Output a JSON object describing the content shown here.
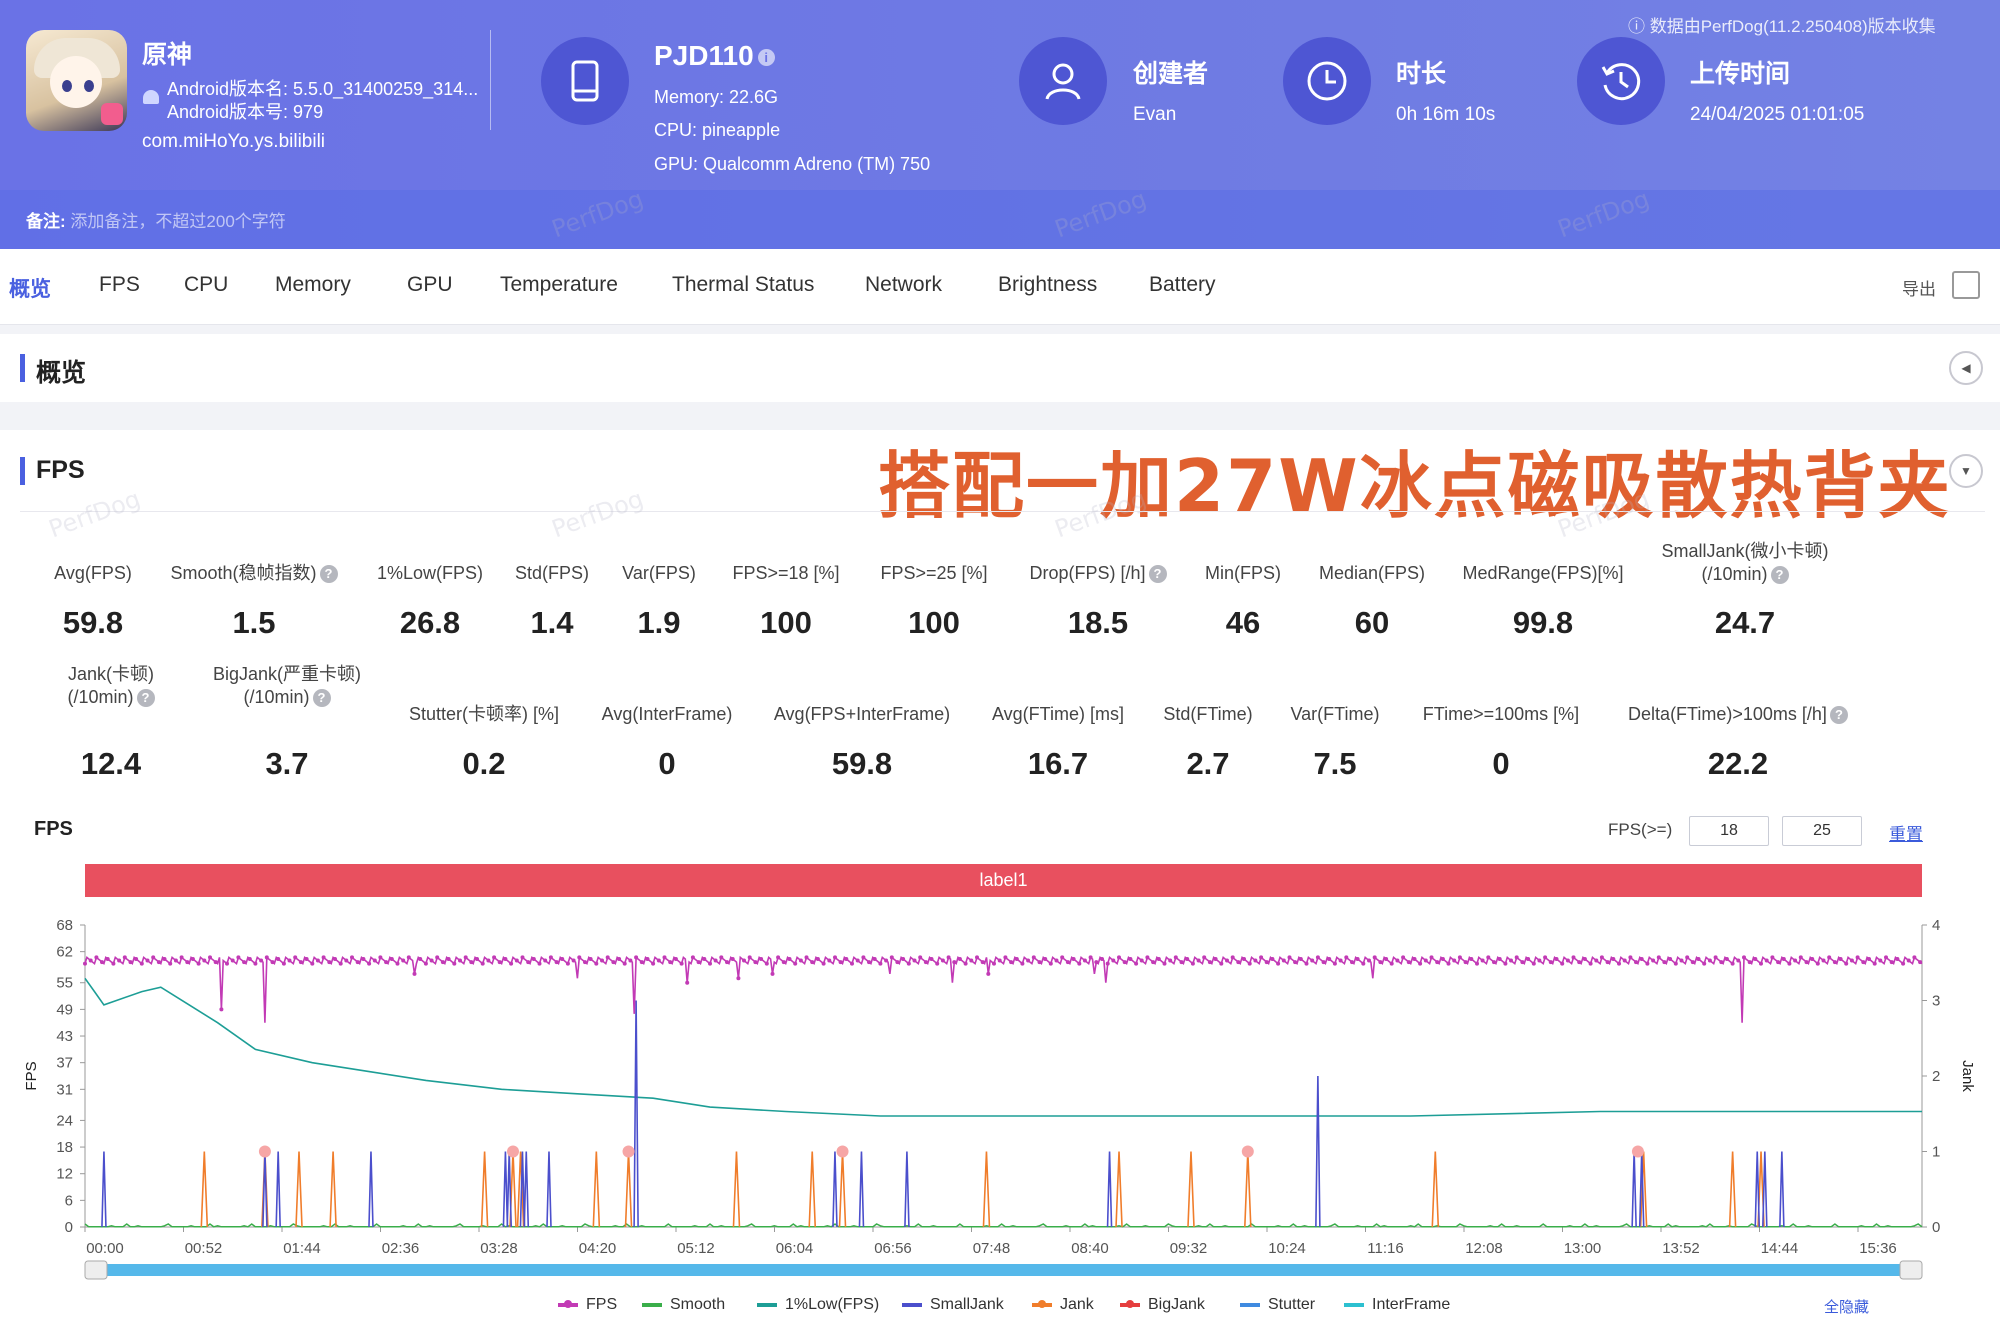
{
  "header": {
    "app_name": "原神",
    "app_version_name": "Android版本名: 5.5.0_31400259_314...",
    "app_version_code": "Android版本号: 979",
    "package": "com.miHoYo.ys.bilibili",
    "device": {
      "name": "PJD110",
      "info_icon": "i",
      "memory": "Memory: 22.6G",
      "cpu": "CPU: pineapple",
      "gpu": "GPU: Qualcomm Adreno (TM) 750"
    },
    "creator": {
      "label": "创建者",
      "value": "Evan"
    },
    "duration": {
      "label": "时长",
      "value": "0h 16m 10s"
    },
    "upload": {
      "label": "上传时间",
      "value": "24/04/2025 01:01:05"
    },
    "source_note": "ⓘ 数据由PerfDog(11.2.250408)版本收集",
    "remark_label": "备注:",
    "remark_placeholder": "添加备注，不超过200个字符",
    "watermark": "PerfDog"
  },
  "tabs": [
    "概览",
    "FPS",
    "CPU",
    "Memory",
    "GPU",
    "Temperature",
    "Thermal Status",
    "Network",
    "Brightness",
    "Battery"
  ],
  "active_tab": "概览",
  "export_label": "导出",
  "overview_title": "概览",
  "fps_section": {
    "title": "FPS",
    "promo_text": "搭配一加27W冰点磁吸散热背夹",
    "help": "?",
    "stats_row1": [
      {
        "label": "Avg(FPS)",
        "value": "59.8"
      },
      {
        "label": "Smooth(稳帧指数)",
        "value": "1.5",
        "help": true
      },
      {
        "label": "1%Low(FPS)",
        "value": "26.8"
      },
      {
        "label": "Std(FPS)",
        "value": "1.4"
      },
      {
        "label": "Var(FPS)",
        "value": "1.9"
      },
      {
        "label": "FPS>=18 [%]",
        "value": "100"
      },
      {
        "label": "FPS>=25 [%]",
        "value": "100"
      },
      {
        "label": "Drop(FPS) [/h]",
        "value": "18.5",
        "help": true
      },
      {
        "label": "Min(FPS)",
        "value": "46"
      },
      {
        "label": "Median(FPS)",
        "value": "60"
      },
      {
        "label": "MedRange(FPS)[%]",
        "value": "99.8"
      },
      {
        "label": "SmallJank(微小卡顿)",
        "label2": "(/10min)",
        "value": "24.7",
        "help": true
      }
    ],
    "stats_row2": [
      {
        "label": "Jank(卡顿)",
        "label2": "(/10min)",
        "value": "12.4",
        "help": true
      },
      {
        "label": "BigJank(严重卡顿)",
        "label2": "(/10min)",
        "value": "3.7",
        "help": true
      },
      {
        "label": "Stutter(卡顿率) [%]",
        "value": "0.2"
      },
      {
        "label": "Avg(InterFrame)",
        "value": "0"
      },
      {
        "label": "Avg(FPS+InterFrame)",
        "value": "59.8"
      },
      {
        "label": "Avg(FTime) [ms]",
        "value": "16.7"
      },
      {
        "label": "Std(FTime)",
        "value": "2.7"
      },
      {
        "label": "Var(FTime)",
        "value": "7.5"
      },
      {
        "label": "FTime>=100ms [%]",
        "value": "0"
      },
      {
        "label": "Delta(FTime)>100ms [/h]",
        "value": "22.2",
        "help": true
      }
    ]
  },
  "chart_controls": {
    "title": "FPS",
    "threshold_label": "FPS(>=)",
    "threshold_low": "18",
    "threshold_high": "25",
    "reset_label": "重置",
    "range_label": "label1",
    "hide_all_label": "全隐藏"
  },
  "chart_data": {
    "type": "line",
    "title": "FPS",
    "ylabel": "FPS",
    "y2label": "Jank",
    "y_ticks": [
      "0",
      "6",
      "12",
      "18",
      "24",
      "31",
      "37",
      "43",
      "49",
      "55",
      "62",
      "68"
    ],
    "y_ticks_values": [
      0,
      6,
      12,
      18,
      24,
      31,
      37,
      43,
      49,
      55,
      62,
      68
    ],
    "y2_ticks": [
      "0",
      "1",
      "2",
      "3",
      "4"
    ],
    "ylim": [
      0,
      68
    ],
    "y2lim": [
      0,
      4
    ],
    "x_ticks": [
      "00:00",
      "00:52",
      "01:44",
      "02:36",
      "03:28",
      "04:20",
      "05:12",
      "06:04",
      "06:56",
      "07:48",
      "08:40",
      "09:32",
      "10:24",
      "11:16",
      "12:08",
      "13:00",
      "13:52",
      "14:44",
      "15:36"
    ],
    "duration_s": 970,
    "series": [
      {
        "name": "FPS",
        "color": "#c23ab5",
        "baseline": 60,
        "drops": [
          [
            72,
            49
          ],
          [
            95,
            57
          ],
          [
            174,
            57
          ],
          [
            260,
            56
          ],
          [
            290,
            56
          ],
          [
            318,
            55
          ],
          [
            345,
            56
          ],
          [
            363,
            57
          ],
          [
            425,
            57
          ],
          [
            458,
            55
          ],
          [
            477,
            57
          ],
          [
            533,
            57
          ],
          [
            539,
            55
          ],
          [
            680,
            56
          ],
          [
            1009,
            55
          ],
          [
            1316,
            58
          ],
          [
            1322,
            55
          ]
        ],
        "min_drop": [
          [
            95,
            46
          ],
          [
            290,
            48
          ],
          [
            875,
            46
          ]
        ]
      },
      {
        "name": "Smooth",
        "color": "#3aae4a",
        "note": "near zero, small spikes"
      },
      {
        "name": "1%Low(FPS)",
        "color": "#1d9e96",
        "points": [
          [
            0,
            56
          ],
          [
            5,
            53
          ],
          [
            10,
            50
          ],
          [
            30,
            53
          ],
          [
            40,
            54
          ],
          [
            55,
            50
          ],
          [
            70,
            46
          ],
          [
            90,
            40
          ],
          [
            120,
            37
          ],
          [
            150,
            35
          ],
          [
            180,
            33
          ],
          [
            220,
            31
          ],
          [
            260,
            30
          ],
          [
            300,
            29
          ],
          [
            330,
            27
          ],
          [
            370,
            26
          ],
          [
            420,
            25
          ],
          [
            500,
            25
          ],
          [
            600,
            25
          ],
          [
            700,
            25
          ],
          [
            800,
            26
          ],
          [
            900,
            26
          ],
          [
            970,
            26
          ]
        ]
      },
      {
        "name": "SmallJank",
        "color": "#4b4fcc",
        "spikes": [
          [
            10,
            1
          ],
          [
            95,
            1
          ],
          [
            102,
            1
          ],
          [
            151,
            1
          ],
          [
            222,
            1
          ],
          [
            224,
            1
          ],
          [
            231,
            1
          ],
          [
            233,
            1
          ],
          [
            245,
            1
          ],
          [
            291,
            3
          ],
          [
            396,
            1
          ],
          [
            410,
            1
          ],
          [
            434,
            1
          ],
          [
            541,
            1
          ],
          [
            651,
            2
          ],
          [
            818,
            1
          ],
          [
            822,
            1
          ],
          [
            883,
            1
          ],
          [
            887,
            1
          ],
          [
            896,
            1
          ]
        ]
      },
      {
        "name": "Jank",
        "color": "#f07d2b",
        "spikes": [
          [
            63,
            1
          ],
          [
            95,
            1
          ],
          [
            113,
            1
          ],
          [
            131,
            1
          ],
          [
            211,
            1
          ],
          [
            226,
            1
          ],
          [
            230,
            1
          ],
          [
            270,
            1
          ],
          [
            287,
            1
          ],
          [
            344,
            1
          ],
          [
            384,
            1
          ],
          [
            400,
            1
          ],
          [
            476,
            1
          ],
          [
            546,
            1
          ],
          [
            584,
            1
          ],
          [
            614,
            1
          ],
          [
            713,
            1
          ],
          [
            823,
            1
          ],
          [
            870,
            1
          ],
          [
            885,
            1
          ]
        ]
      },
      {
        "name": "BigJank",
        "color": "#e53e3e",
        "points": [
          [
            95,
            1
          ],
          [
            226,
            1
          ],
          [
            287,
            1
          ],
          [
            400,
            1
          ],
          [
            614,
            1
          ],
          [
            820,
            1
          ]
        ]
      },
      {
        "name": "Stutter",
        "color": "#3f8ae0"
      },
      {
        "name": "InterFrame",
        "color": "#2cc0d0"
      }
    ]
  }
}
